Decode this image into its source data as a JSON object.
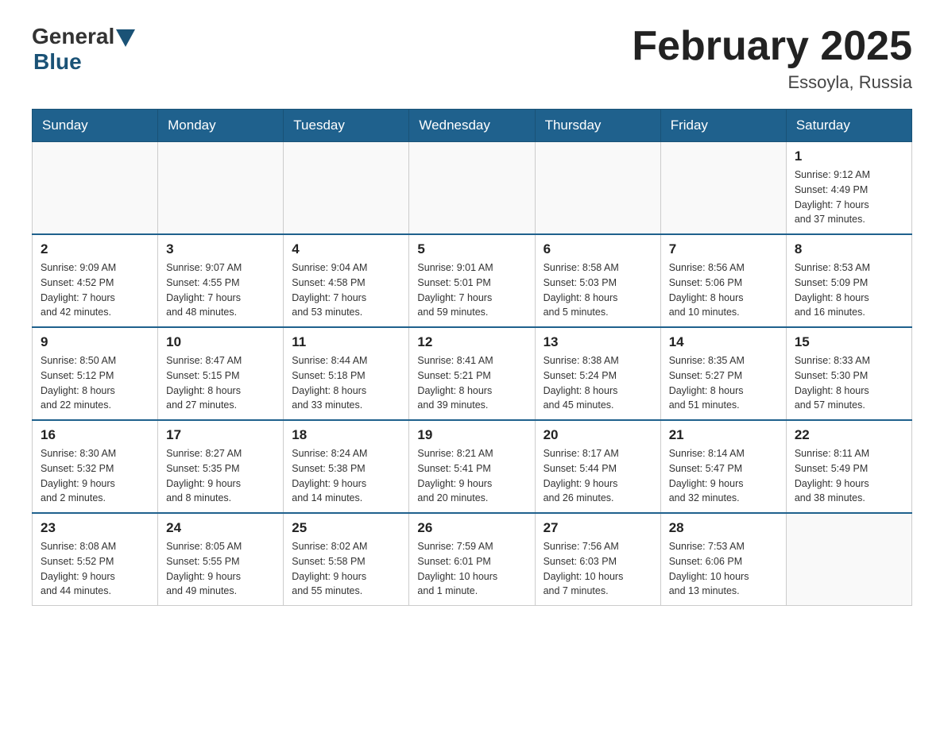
{
  "logo": {
    "general": "General",
    "blue": "Blue"
  },
  "header": {
    "month_title": "February 2025",
    "subtitle": "Essoyla, Russia"
  },
  "days_of_week": [
    "Sunday",
    "Monday",
    "Tuesday",
    "Wednesday",
    "Thursday",
    "Friday",
    "Saturday"
  ],
  "weeks": [
    {
      "days": [
        {
          "num": "",
          "info": ""
        },
        {
          "num": "",
          "info": ""
        },
        {
          "num": "",
          "info": ""
        },
        {
          "num": "",
          "info": ""
        },
        {
          "num": "",
          "info": ""
        },
        {
          "num": "",
          "info": ""
        },
        {
          "num": "1",
          "info": "Sunrise: 9:12 AM\nSunset: 4:49 PM\nDaylight: 7 hours\nand 37 minutes."
        }
      ]
    },
    {
      "days": [
        {
          "num": "2",
          "info": "Sunrise: 9:09 AM\nSunset: 4:52 PM\nDaylight: 7 hours\nand 42 minutes."
        },
        {
          "num": "3",
          "info": "Sunrise: 9:07 AM\nSunset: 4:55 PM\nDaylight: 7 hours\nand 48 minutes."
        },
        {
          "num": "4",
          "info": "Sunrise: 9:04 AM\nSunset: 4:58 PM\nDaylight: 7 hours\nand 53 minutes."
        },
        {
          "num": "5",
          "info": "Sunrise: 9:01 AM\nSunset: 5:01 PM\nDaylight: 7 hours\nand 59 minutes."
        },
        {
          "num": "6",
          "info": "Sunrise: 8:58 AM\nSunset: 5:03 PM\nDaylight: 8 hours\nand 5 minutes."
        },
        {
          "num": "7",
          "info": "Sunrise: 8:56 AM\nSunset: 5:06 PM\nDaylight: 8 hours\nand 10 minutes."
        },
        {
          "num": "8",
          "info": "Sunrise: 8:53 AM\nSunset: 5:09 PM\nDaylight: 8 hours\nand 16 minutes."
        }
      ]
    },
    {
      "days": [
        {
          "num": "9",
          "info": "Sunrise: 8:50 AM\nSunset: 5:12 PM\nDaylight: 8 hours\nand 22 minutes."
        },
        {
          "num": "10",
          "info": "Sunrise: 8:47 AM\nSunset: 5:15 PM\nDaylight: 8 hours\nand 27 minutes."
        },
        {
          "num": "11",
          "info": "Sunrise: 8:44 AM\nSunset: 5:18 PM\nDaylight: 8 hours\nand 33 minutes."
        },
        {
          "num": "12",
          "info": "Sunrise: 8:41 AM\nSunset: 5:21 PM\nDaylight: 8 hours\nand 39 minutes."
        },
        {
          "num": "13",
          "info": "Sunrise: 8:38 AM\nSunset: 5:24 PM\nDaylight: 8 hours\nand 45 minutes."
        },
        {
          "num": "14",
          "info": "Sunrise: 8:35 AM\nSunset: 5:27 PM\nDaylight: 8 hours\nand 51 minutes."
        },
        {
          "num": "15",
          "info": "Sunrise: 8:33 AM\nSunset: 5:30 PM\nDaylight: 8 hours\nand 57 minutes."
        }
      ]
    },
    {
      "days": [
        {
          "num": "16",
          "info": "Sunrise: 8:30 AM\nSunset: 5:32 PM\nDaylight: 9 hours\nand 2 minutes."
        },
        {
          "num": "17",
          "info": "Sunrise: 8:27 AM\nSunset: 5:35 PM\nDaylight: 9 hours\nand 8 minutes."
        },
        {
          "num": "18",
          "info": "Sunrise: 8:24 AM\nSunset: 5:38 PM\nDaylight: 9 hours\nand 14 minutes."
        },
        {
          "num": "19",
          "info": "Sunrise: 8:21 AM\nSunset: 5:41 PM\nDaylight: 9 hours\nand 20 minutes."
        },
        {
          "num": "20",
          "info": "Sunrise: 8:17 AM\nSunset: 5:44 PM\nDaylight: 9 hours\nand 26 minutes."
        },
        {
          "num": "21",
          "info": "Sunrise: 8:14 AM\nSunset: 5:47 PM\nDaylight: 9 hours\nand 32 minutes."
        },
        {
          "num": "22",
          "info": "Sunrise: 8:11 AM\nSunset: 5:49 PM\nDaylight: 9 hours\nand 38 minutes."
        }
      ]
    },
    {
      "days": [
        {
          "num": "23",
          "info": "Sunrise: 8:08 AM\nSunset: 5:52 PM\nDaylight: 9 hours\nand 44 minutes."
        },
        {
          "num": "24",
          "info": "Sunrise: 8:05 AM\nSunset: 5:55 PM\nDaylight: 9 hours\nand 49 minutes."
        },
        {
          "num": "25",
          "info": "Sunrise: 8:02 AM\nSunset: 5:58 PM\nDaylight: 9 hours\nand 55 minutes."
        },
        {
          "num": "26",
          "info": "Sunrise: 7:59 AM\nSunset: 6:01 PM\nDaylight: 10 hours\nand 1 minute."
        },
        {
          "num": "27",
          "info": "Sunrise: 7:56 AM\nSunset: 6:03 PM\nDaylight: 10 hours\nand 7 minutes."
        },
        {
          "num": "28",
          "info": "Sunrise: 7:53 AM\nSunset: 6:06 PM\nDaylight: 10 hours\nand 13 minutes."
        },
        {
          "num": "",
          "info": ""
        }
      ]
    }
  ]
}
